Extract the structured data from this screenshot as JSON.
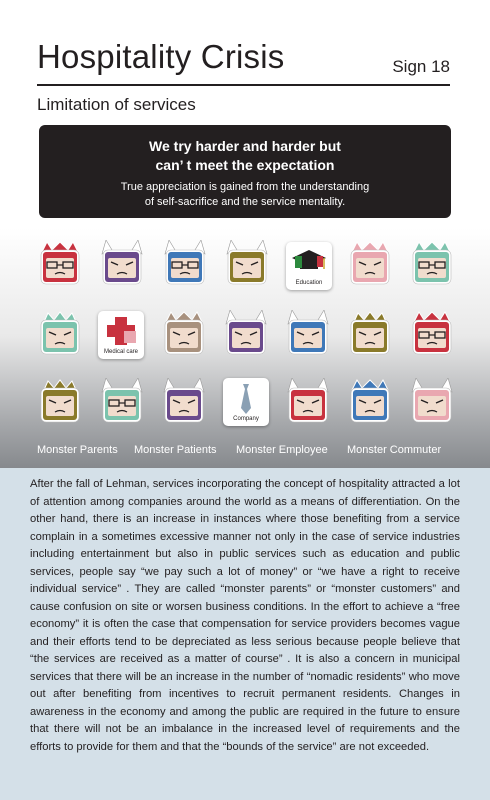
{
  "header": {
    "title": "Hospitality Crisis",
    "sign": "Sign 18",
    "subtitle": "Limitation of services"
  },
  "banner": {
    "headline_line1": "We try harder and harder but",
    "headline_line2": "can’ t meet the expectation",
    "sub_line1": "True appreciation is gained from the understanding",
    "sub_line2": "of self-sacrifice and the service mentality."
  },
  "icons": {
    "education_caption": "Education",
    "medical_caption": "Medical care",
    "company_caption": "Company"
  },
  "legend": {
    "parents": "Monster Parents",
    "patients": "Monster Patients",
    "employee": "Monster Employee",
    "commuter": "Monster Commuter"
  },
  "colors": {
    "dark": "#231f20",
    "body_bg": "#d4e0e8",
    "monster_red": "#c8323f",
    "monster_purple": "#6a4a8c",
    "monster_blue": "#3f78b8",
    "monster_olive": "#8a7a2a",
    "monster_pink": "#e9a7b0",
    "monster_teal": "#7cc3ad",
    "monster_tan": "#a8917e"
  },
  "body_text": "After the fall of Lehman, services incorporating the concept of hospitality attracted a lot of attention among companies around the world as a means of differentiation. On the other hand, there is an increase in instances where those benefiting from a service complain in a sometimes excessive manner not only in the case of service industries including entertainment but also in public services such as education and public services, people say “we pay such a lot of money” or “we have a right to receive individual service” . They are called “monster parents” or “monster customers” and cause confusion on site or worsen business conditions. In the effort to achieve a “free economy” it is often the case that compensation for service providers becomes vague and their efforts tend to be depreciated as less serious because people believe that “the services are received as a matter of course” . It is also a concern in municipal services that there will be an increase in the number of “nomadic residents” who move out after benefiting from incentives to recruit permanent residents. Changes in awareness in the economy and among the public are required in the future to ensure that there will not be an imbalance in the increased level of requirements and the efforts to provide for them and that the “bounds of the service” are not exceeded."
}
